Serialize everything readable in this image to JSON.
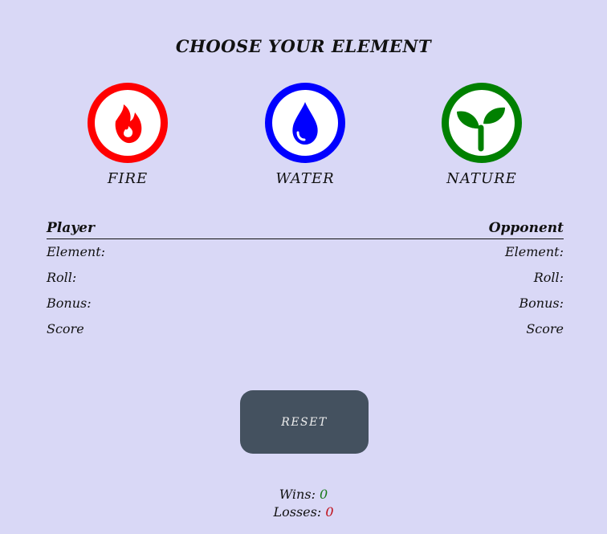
{
  "title": "CHOOSE YOUR ELEMENT",
  "elements": [
    {
      "label": "FIRE",
      "color": "#ff0000",
      "icon": "fire-icon"
    },
    {
      "label": "WATER",
      "color": "#0000ff",
      "icon": "water-drop-icon"
    },
    {
      "label": "NATURE",
      "color": "#008000",
      "icon": "sprout-icon"
    }
  ],
  "stats": {
    "player_header": "Player",
    "opponent_header": "Opponent",
    "rows": [
      {
        "player": "Element:",
        "opponent": "Element:"
      },
      {
        "player": "Roll:",
        "opponent": "Roll:"
      },
      {
        "player": "Bonus:",
        "opponent": "Bonus:"
      },
      {
        "player": "Score",
        "opponent": "Score"
      }
    ]
  },
  "reset_label": "RESET",
  "record": {
    "wins_label": "Wins:",
    "wins_value": "0",
    "wins_color": "#1a7a1a",
    "losses_label": "Losses:",
    "losses_value": "0",
    "losses_color": "#c0101a"
  }
}
